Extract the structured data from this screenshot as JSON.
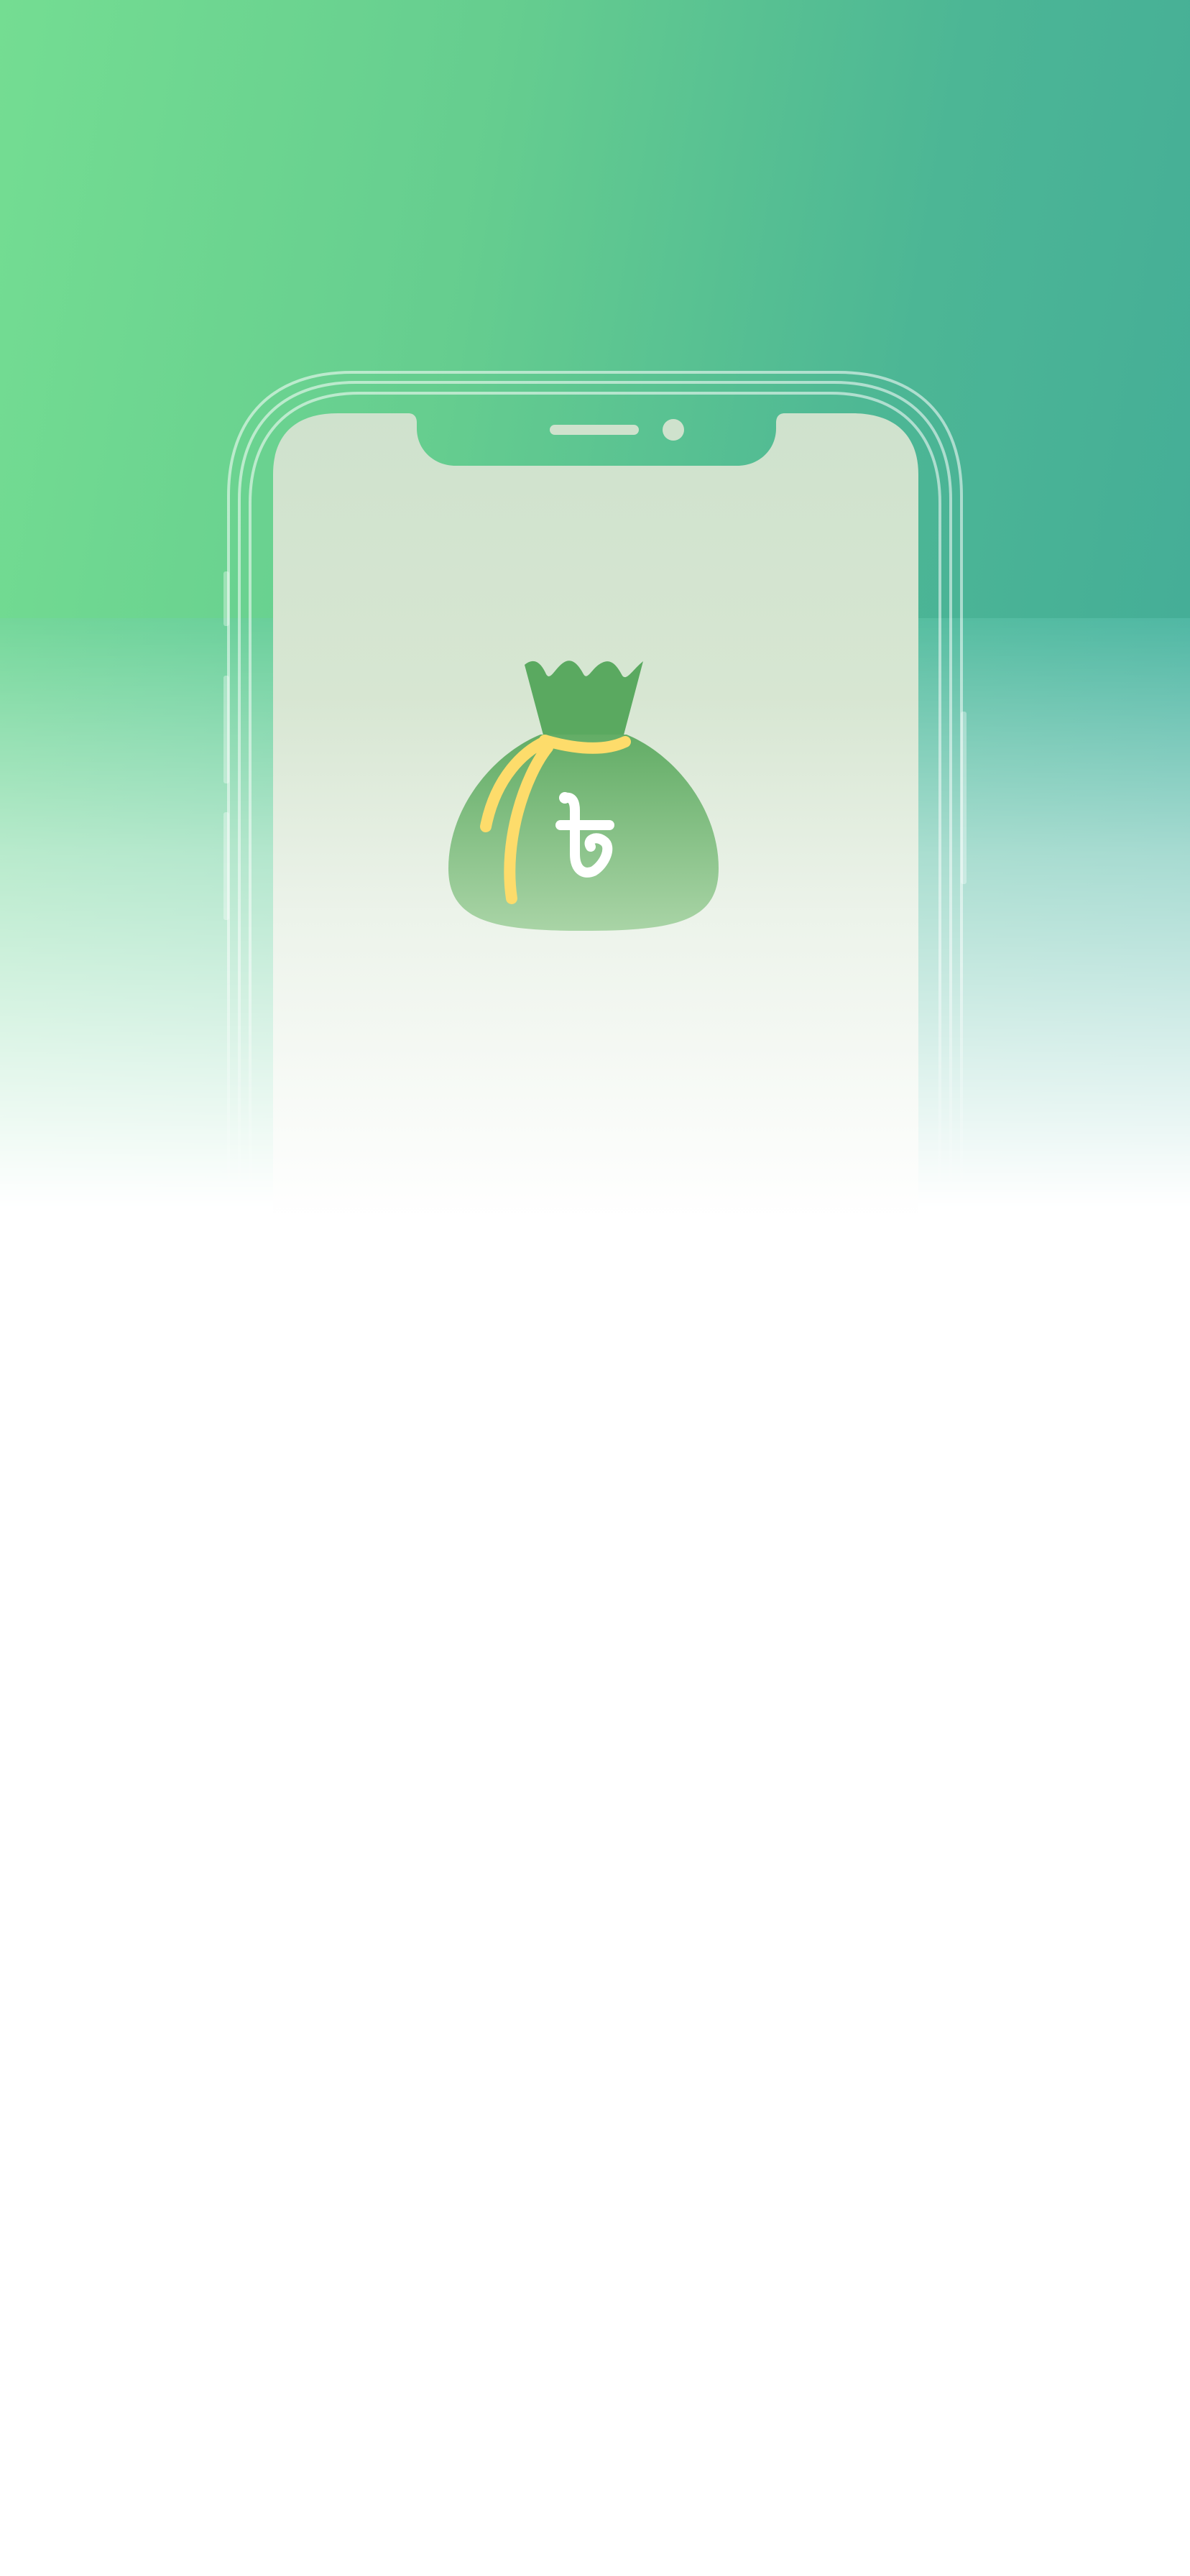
{
  "screen": {
    "name": "splash-screen",
    "colors": {
      "gradient_start": "#74dd92",
      "gradient_end": "#45ae97",
      "bag_dark": "#5aa960",
      "bag_light": "#a6d4a4",
      "cord": "#fddc6b",
      "screen_top": "#cfe2cd",
      "screen_bottom": "#ffffff"
    },
    "icons": {
      "phone": "smartphone-outline-icon",
      "bag": "money-bag-icon",
      "currency_symbol": "bangladeshi-taka-sign"
    }
  }
}
